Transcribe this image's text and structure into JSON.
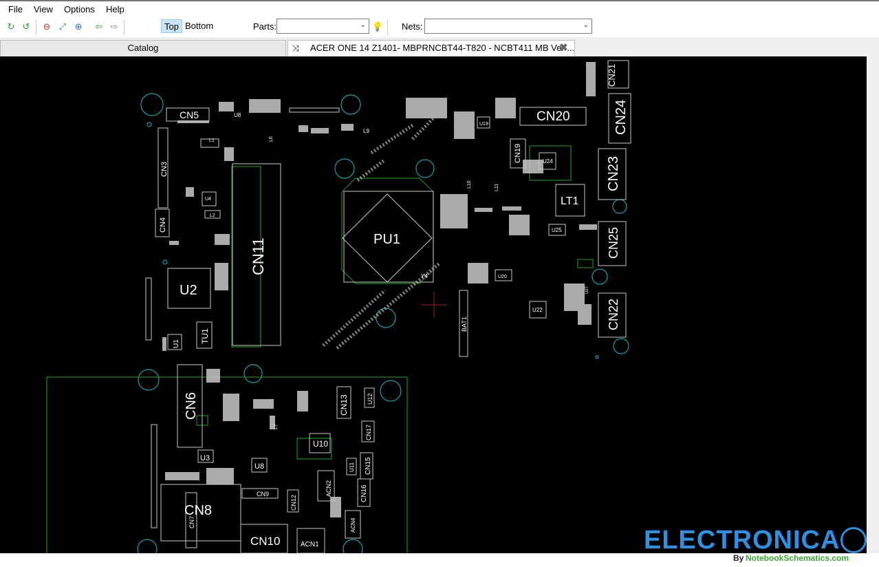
{
  "menu": {
    "items": [
      "File",
      "View",
      "Options",
      "Help"
    ]
  },
  "toolbar": {
    "layers": {
      "top": "Top",
      "bottom": "Bottom",
      "active": "Top"
    },
    "parts_label": "Parts:",
    "parts_value": "",
    "nets_label": "Nets:",
    "nets_value": ""
  },
  "tabs": {
    "catalog": "Catalog",
    "board": "ACER ONE 14 Z1401- MBPRNCBT44-T820 - NCBT411 MB Ver ..."
  },
  "board": {
    "components": {
      "CN5": "CN5",
      "CN3": "CN3",
      "CN4": "CN4",
      "U2": "U2",
      "U1": "U1",
      "TU1": "TU1",
      "U4": "U4",
      "L1": "L1",
      "L2": "L2",
      "L6": "L6",
      "L9": "L9",
      "U8_top": "U8",
      "CN11": "CN11",
      "PU1": "PU1",
      "Y4": "Y4",
      "BAT1": "BAT1",
      "CN20": "CN20",
      "CN19": "CN19",
      "U19": "U19",
      "U24": "U24",
      "L10": "L10",
      "L11": "L11",
      "LT1": "LT1",
      "U25": "U25",
      "U20": "U20",
      "U22": "U22",
      "U27": "U27",
      "CN21": "CN21",
      "CN24": "CN24",
      "CN23": "CN23",
      "CN25": "CN25",
      "CN22": "CN22",
      "CN6": "CN6",
      "U3": "U3",
      "U8": "U8",
      "L7": "L7",
      "CN8": "CN8",
      "CN7": "CN7",
      "CN9": "CN9",
      "CN10": "CN10",
      "CN12": "CN12",
      "ACN1": "ACN1",
      "ACN2": "ACN2",
      "U10": "U10",
      "CN13": "CN13",
      "U12": "U12",
      "CN17": "CN17",
      "U11": "U11",
      "CN15": "CN15",
      "CN16": "CN16",
      "ACN4": "ACN4"
    }
  },
  "watermark": {
    "brand": "ELECTRONICA",
    "by": "By",
    "site": "NotebookSchematics.com"
  },
  "colors": {
    "canvas": "#000000",
    "silkscreen": "#c8c8c8",
    "outline": "#1f8a1f",
    "hole": "#1aa0a8",
    "brand": "#2f8fe0",
    "site": "#3aa832"
  },
  "icons": [
    "refresh-icon",
    "reload-icon",
    "zoom-out-icon",
    "fit-icon",
    "zoom-in-icon",
    "back-arrow-icon",
    "forward-arrow-icon",
    "bulb-icon",
    "pin-icon",
    "close-icon"
  ]
}
